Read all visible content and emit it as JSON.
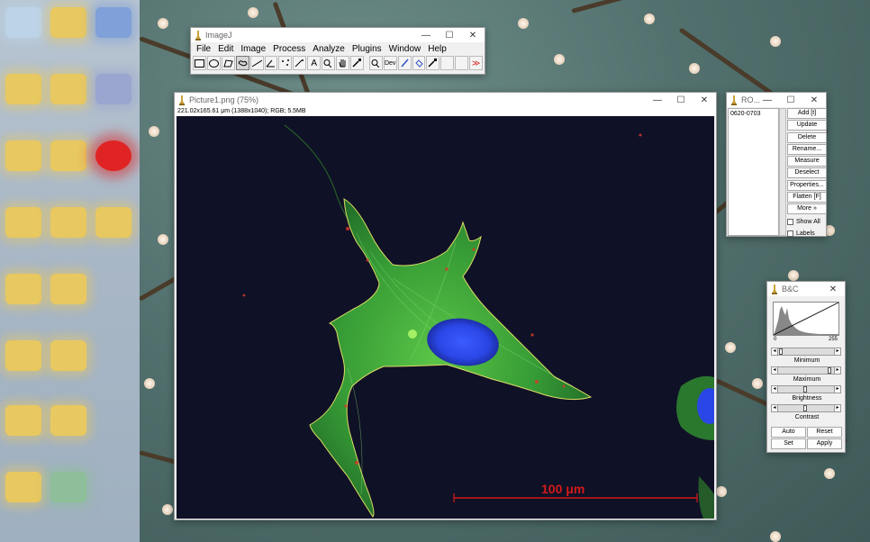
{
  "imagej": {
    "title": "ImageJ",
    "menu": [
      "File",
      "Edit",
      "Image",
      "Process",
      "Analyze",
      "Plugins",
      "Window",
      "Help"
    ],
    "tools": [
      "rectangle-tool",
      "oval-tool",
      "polygon-tool",
      "freehand-tool",
      "line-tool",
      "angle-tool",
      "multipoint-tool",
      "wand-tool",
      "text-tool",
      "magnifying-glass-tool",
      "hand-tool",
      "color-picker-tool",
      "zoom-tool",
      "developer-menu",
      "brush-tool",
      "flood-fill-tool",
      "pipette-tool",
      "spare-tool-1",
      "spare-tool-2",
      "more-tools"
    ],
    "dev_label": "Dev",
    "more_label": "≫"
  },
  "image_window": {
    "title": "Picture1.png (75%)",
    "info": "221.02x165.61 μm (1388x1040); RGB; 5.5MB",
    "scalebar_label": "100 μm"
  },
  "roi_manager": {
    "title": "RO...",
    "items": [
      "0620-0703"
    ],
    "buttons": [
      "Add [t]",
      "Update",
      "Delete",
      "Rename...",
      "Measure",
      "Deselect",
      "Properties...",
      "Flatten [F]",
      "More »"
    ],
    "checkboxes": [
      "Show All",
      "Labels"
    ]
  },
  "bc": {
    "title": "B&C",
    "hist_min": "0",
    "hist_max": "255",
    "sliders": [
      "Minimum",
      "Maximum",
      "Brightness",
      "Contrast"
    ],
    "buttons": [
      "Auto",
      "Reset",
      "Set",
      "Apply"
    ]
  },
  "window_controls": {
    "minimize": "—",
    "maximize": "☐",
    "close": "✕"
  },
  "colors": {
    "cell_green": "#3fae3a",
    "nucleus_blue": "#2c4cf0",
    "outline_yellow": "#e9e86a",
    "scalebar_red": "#d41a1a",
    "bg_dark": "#0f1126"
  }
}
